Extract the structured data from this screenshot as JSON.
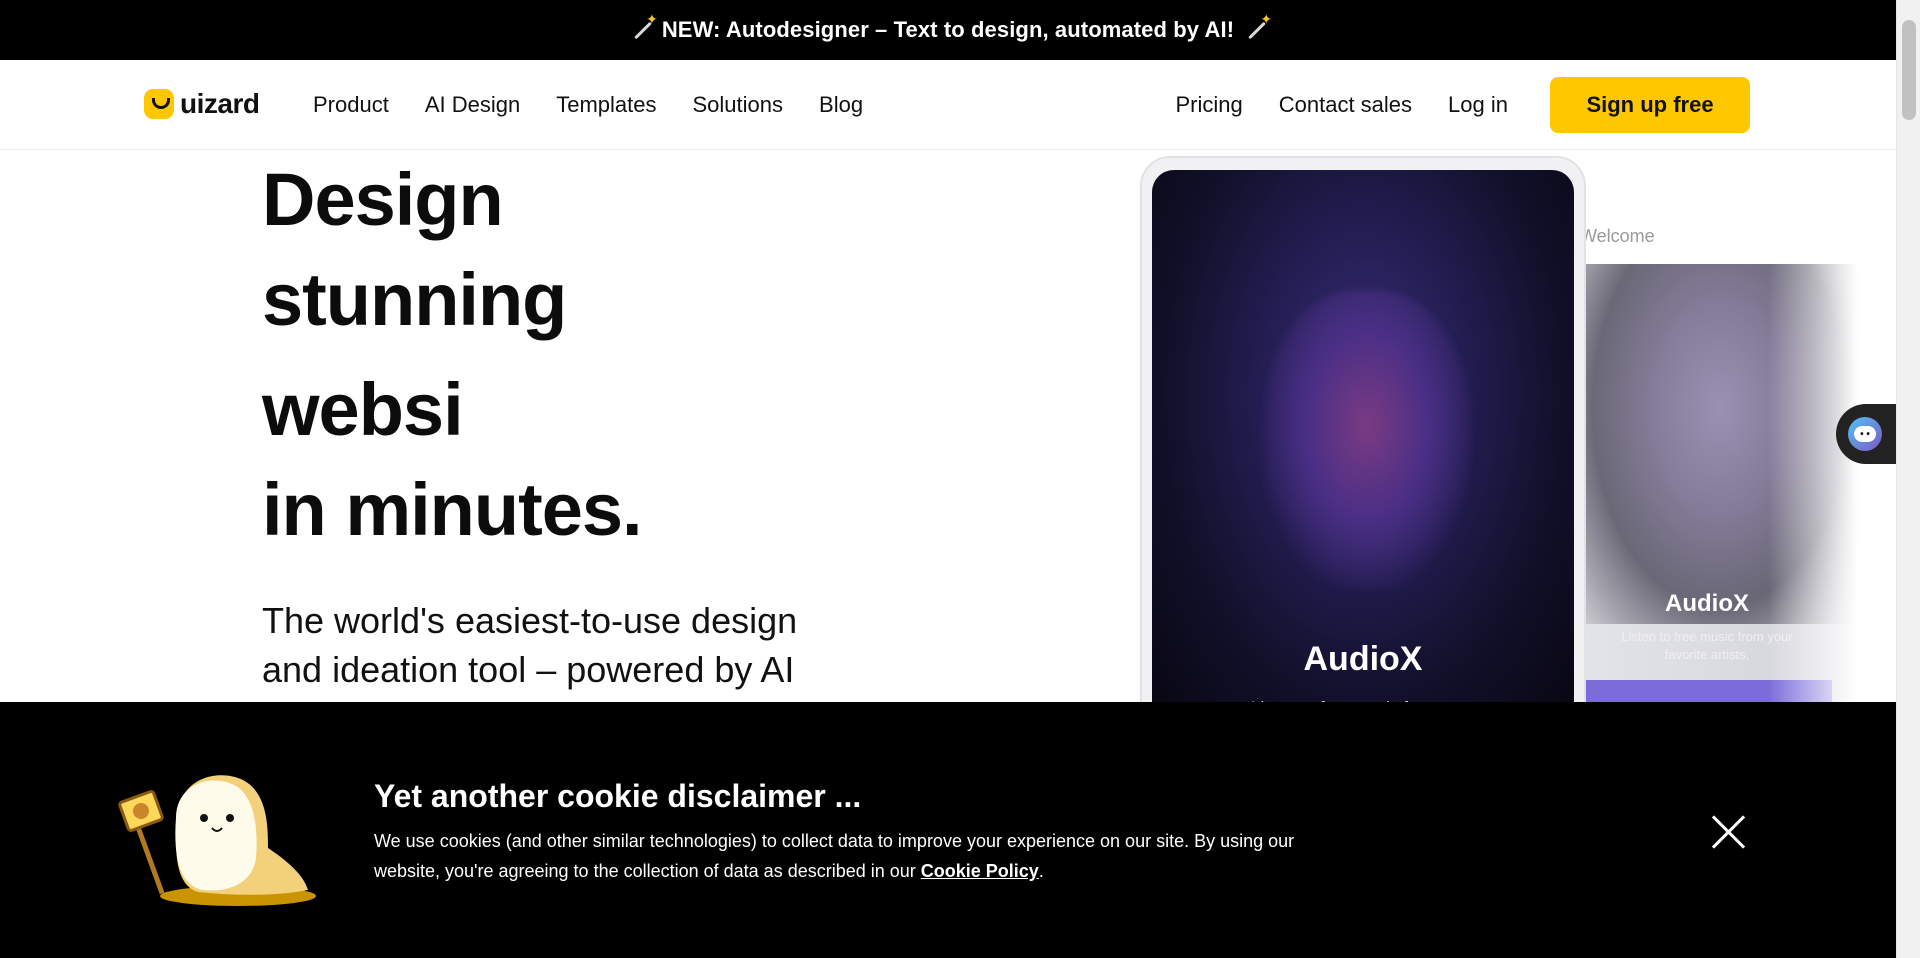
{
  "announcement": {
    "text": "NEW: Autodesigner – Text to design, automated by AI!"
  },
  "nav": {
    "logo_text": "uizard",
    "left_links": [
      "Product",
      "AI Design",
      "Templates",
      "Solutions",
      "Blog"
    ],
    "right_links": [
      "Pricing",
      "Contact sales",
      "Log in"
    ],
    "signup_label": "Sign up free",
    "accent": "#FFC700"
  },
  "hero": {
    "title_lines": [
      "Design",
      "stunning",
      "websi",
      "in minutes."
    ],
    "subtitle_line1": "The world's easiest-to-use design",
    "subtitle_line2": "and ideation tool – powered by AI"
  },
  "preview": {
    "front_title": "AudioX",
    "front_subtitle": "Listen to free music from your",
    "back_label": "Welcome",
    "back_title": "AudioX",
    "back_subtitle": "Listen to free music from your favorite artists."
  },
  "cookie": {
    "title": "Yet another cookie disclaimer ...",
    "text": "We use cookies (and other similar technologies) to collect data to improve your experience on our site. By using our website, you're agreeing to the collection of data as described in our ",
    "link_text": "Cookie Policy",
    "trailing": "."
  }
}
